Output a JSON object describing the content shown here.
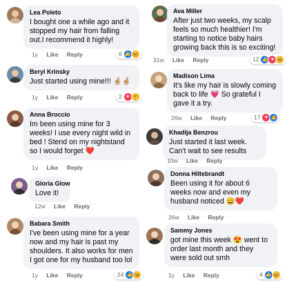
{
  "left": [
    {
      "name": "Lea Poleto",
      "text": "I bought one a while ago and it stopped my hair from falling out.I recommend it highly!",
      "time": "1y",
      "like": "Like",
      "reply": "Reply",
      "count": "6",
      "avatar_color": "#a17a5b"
    },
    {
      "name": "Beryl Krinsky",
      "text": "Just started using mine!!! 🤞🏼🤞🏼",
      "time": "1y",
      "like": "Like",
      "reply": "Reply",
      "count": "2",
      "avatar_color": "#6d8ca8"
    },
    {
      "name": "Anna Broccio",
      "text": "Im been using mine for 3 weeks! I use every night wild in bed ! Stend on my nightstand so I would forget ❤️",
      "time": "1y",
      "like": "Like",
      "reply": "Reply",
      "count": "",
      "avatar_color": "#8a5a44"
    },
    {
      "name": "Gloria Glow",
      "text": "Love it!",
      "time": "12w",
      "like": "Like",
      "reply": "Reply",
      "count": "",
      "avatar_color": "#7b5e8e"
    },
    {
      "name": "Babara Smith",
      "text": "I've been using mine for a year now and my hair is past my shoulders. It also works for men I got one for my husband too lol",
      "time": "1y",
      "like": "Like",
      "reply": "Reply",
      "count": "24",
      "avatar_color": "#b08968"
    }
  ],
  "right": [
    {
      "name": "Ava Miller",
      "text": "After just two weeks, my scalp feels so much healthier! I'm starting to notice baby hairs growing back this is so exciting!",
      "time": "31w",
      "like": "Like",
      "reply": "Reply",
      "count": "12",
      "avatar_color": "#5f6f52"
    },
    {
      "name": "Madison Lima",
      "text": "It's like my hair is slowly coming back to life 💗 So grateful I gave it a try.",
      "time": "26w",
      "like": "Like",
      "reply": "Reply",
      "count": "17",
      "avatar_color": "#c6a27e"
    },
    {
      "name": "Khadija Benzrou",
      "text": "Just started it last week. Can't wait to see results",
      "time": "10w",
      "like": "Like",
      "reply": "Reply",
      "count": "",
      "avatar_color": "#3f3a3a"
    },
    {
      "name": "Donna Hiltebrandt",
      "text": "Been using it for about 6 weeks now and even my husband noticed 😄❤️",
      "time": "26w",
      "like": "Like",
      "reply": "Reply",
      "count": "",
      "avatar_color": "#8c6e5d"
    },
    {
      "name": "Sammy Jones",
      "text": "got mine this week 😍 went to order last month and they were sold out smh",
      "time": "1y",
      "like": "Like",
      "reply": "Reply",
      "count": "4",
      "avatar_color": "#9d7455"
    }
  ],
  "colors": {
    "bubble": "#f0f2f5",
    "meta": "#65676b",
    "like": "#1877f2",
    "love": "#f33e58",
    "haha": "#f7b125"
  }
}
